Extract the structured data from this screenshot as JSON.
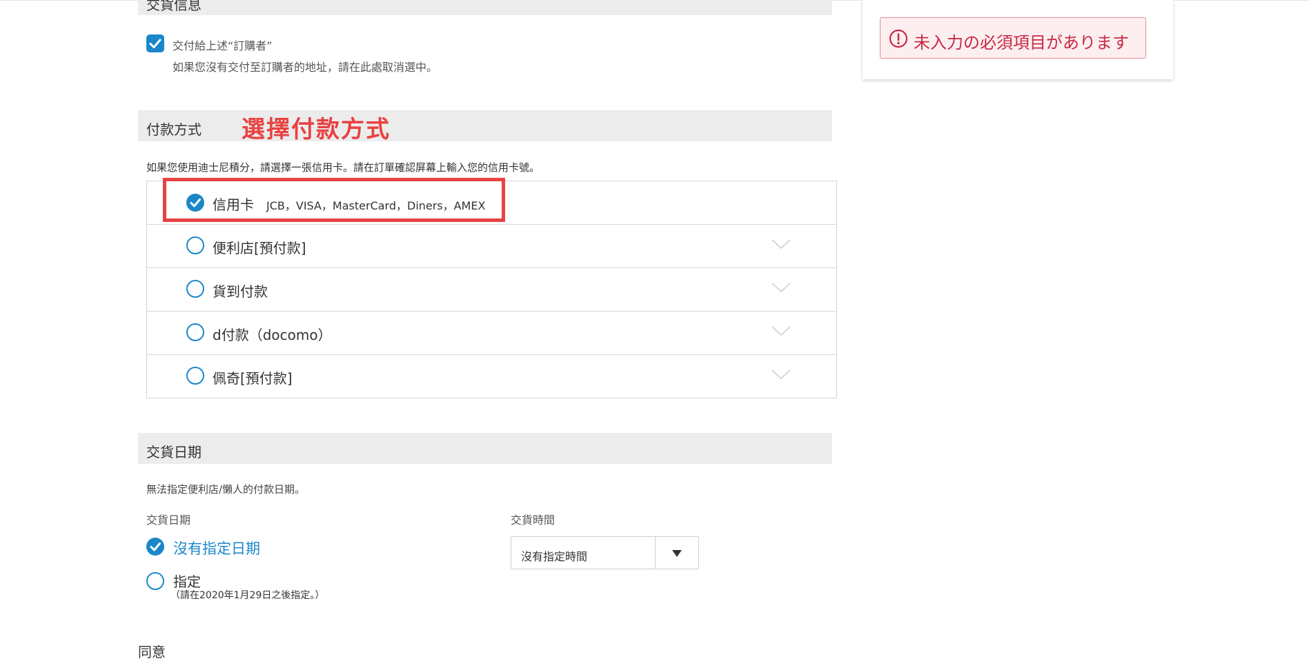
{
  "delivery_info": {
    "section_title": "交貨信息",
    "deliver_to_buyer_label": "交付給上述“訂購者”",
    "deliver_to_buyer_note": "如果您沒有交付至訂購者的地址，請在此處取消選中。",
    "deliver_to_buyer_checked": true
  },
  "alert": {
    "text": "未入力の必須項目があります",
    "color": "#c62a45"
  },
  "payment": {
    "section_title": "付款方式",
    "annotation": "選擇付款方式",
    "note": "如果您使用迪士尼積分，請選擇一張信用卡。請在訂單確認屏幕上輸入您的信用卡號。",
    "options": [
      {
        "label": "信用卡",
        "sub": "JCB，VISA，MasterCard，Diners，AMEX",
        "selected": true
      },
      {
        "label": "便利店[預付款]",
        "sub": "",
        "selected": false
      },
      {
        "label": "貨到付款",
        "sub": "",
        "selected": false
      },
      {
        "label": "d付款（docomo）",
        "sub": "",
        "selected": false
      },
      {
        "label": "佩奇[預付款]",
        "sub": "",
        "selected": false
      }
    ]
  },
  "delivery_date": {
    "section_title": "交貨日期",
    "note": "無法指定便利店/懶人的付款日期。",
    "date_label": "交貨日期",
    "no_date_option": "沒有指定日期",
    "specify_option": "指定",
    "specify_note": "（請在2020年1月29日之後指定。）",
    "time_label": "交貨時間",
    "time_value": "沒有指定時間"
  },
  "bottom": {
    "partial_title": "同意"
  },
  "colors": {
    "accent": "#1b87c9",
    "highlight": "#e94141",
    "band": "#ececec"
  }
}
